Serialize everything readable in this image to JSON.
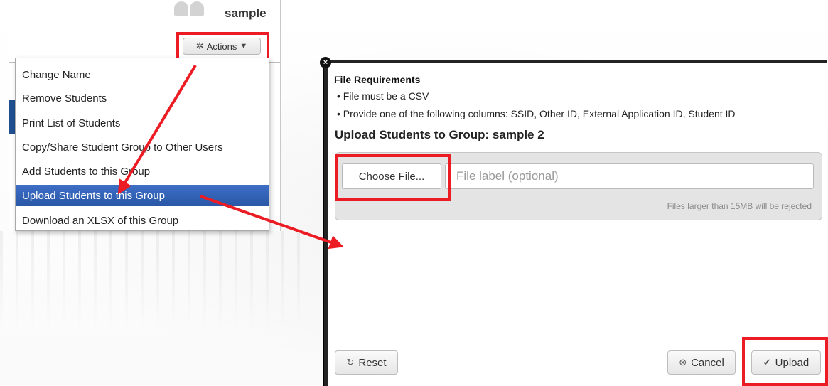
{
  "user": {
    "name": "sample"
  },
  "actions_button": {
    "label": "Actions",
    "icon": "gear-icon",
    "caret": "▼"
  },
  "dropdown": {
    "items": [
      {
        "label": "Change Name"
      },
      {
        "label": "Remove Students"
      },
      {
        "label": "Print List of Students"
      },
      {
        "label": "Copy/Share Student Group to Other Users"
      },
      {
        "label": "Add Students to this Group"
      },
      {
        "label": "Upload Students to this Group",
        "selected": true
      },
      {
        "label": "Download an XLSX of this Group"
      }
    ]
  },
  "modal": {
    "close_icon": "close-icon",
    "requirements_title": "File Requirements",
    "requirements": [
      "• File must be a CSV",
      "• Provide one of the following columns: SSID, Other ID, External Application ID, Student ID"
    ],
    "upload_title": "Upload Students to Group: sample 2",
    "choose_file_label": "Choose File...",
    "file_label_placeholder": "File label (optional)",
    "size_note": "Files larger than 15MB will be rejected",
    "reset_label": "Reset",
    "cancel_label": "Cancel",
    "upload_label": "Upload"
  },
  "annotation": {
    "highlight_color": "#ec1c24"
  }
}
